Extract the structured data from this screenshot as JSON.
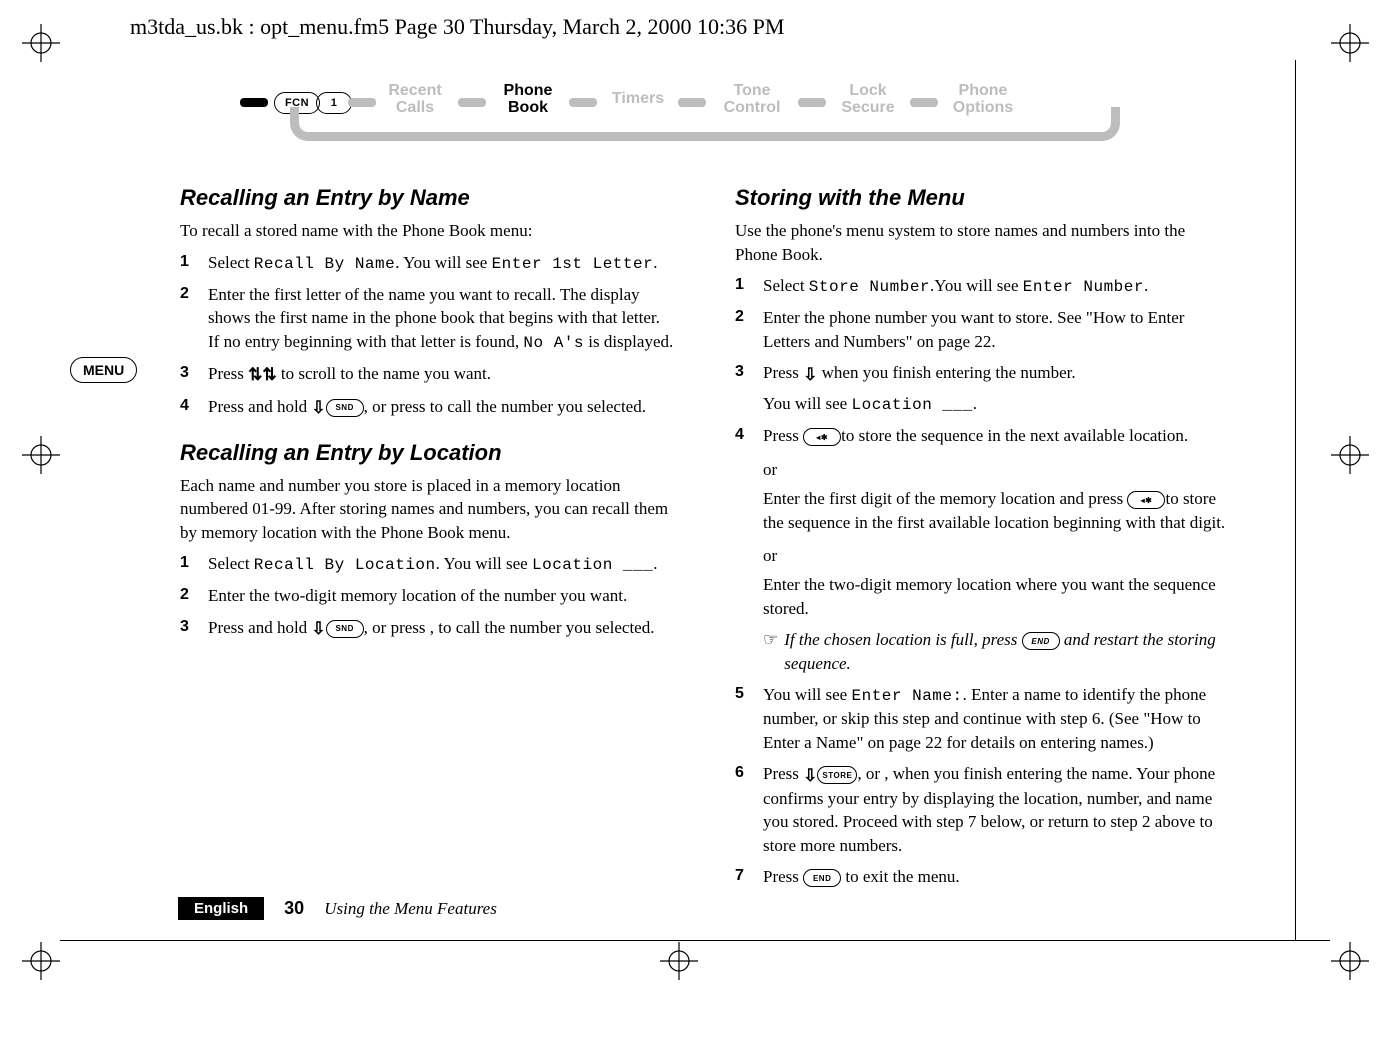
{
  "meta": {
    "headerline": "m3tda_us.bk : opt_menu.fm5  Page 30  Thursday, March 2, 2000  10:36 PM"
  },
  "side": {
    "menu_label": "MENU"
  },
  "nav": {
    "fcn_label": "FCN",
    "num_label": "1",
    "items": [
      {
        "line1": "Recent",
        "line2": "Calls"
      },
      {
        "line1": "Phone",
        "line2": "Book"
      },
      {
        "line1": "Timers",
        "line2": ""
      },
      {
        "line1": "Tone",
        "line2": "Control"
      },
      {
        "line1": "Lock",
        "line2": "Secure"
      },
      {
        "line1": "Phone",
        "line2": "Options"
      }
    ]
  },
  "left": {
    "h1": "Recalling an Entry by Name",
    "p1": "To recall a stored name with the Phone Book menu:",
    "steps1": [
      {
        "n": "1",
        "pre": "Select ",
        "code": "Recall By Name",
        "mid": ". You will see ",
        "code2": "Enter 1st Letter",
        "post": "."
      },
      {
        "n": "2",
        "pre": "Enter the first letter of the name you want to recall. The display shows the first name in the phone book that begins with that letter. If no entry beginning with that letter is found, ",
        "code": "No A's",
        "post": " is displayed."
      },
      {
        "n": "3",
        "pre": "Press ",
        "sym": "updown",
        "post": " to scroll to the name you want."
      },
      {
        "n": "4",
        "pre": "Press and hold ",
        "sym": "down",
        "mid": ", or press ",
        "key": "SND",
        "post": " to call the number you selected."
      }
    ],
    "h2": "Recalling an Entry by Location",
    "p2": "Each name and number you store is placed in a memory location numbered 01-99. After storing names and numbers, you can recall them by memory location with the Phone Book menu.",
    "steps2": [
      {
        "n": "1",
        "pre": "Select ",
        "code": "Recall By Location",
        "mid": ". You will see ",
        "code2": "Location ___",
        "post": "."
      },
      {
        "n": "2",
        "pre": "Enter the two-digit memory location of the number you want."
      },
      {
        "n": "3",
        "pre": "Press and hold ",
        "sym": "down",
        "mid": ", or press ",
        "key": "SND",
        "post": ", to call the number you selected."
      }
    ]
  },
  "right": {
    "h1": "Storing with the Menu",
    "p1": "Use the phone's menu system to store names and numbers into the Phone Book.",
    "steps": [
      {
        "n": "1",
        "pre": "Select ",
        "code": "Store Number",
        "mid": ".You will see ",
        "code2": "Enter Number",
        "post": "."
      },
      {
        "n": "2",
        "pre": "Enter the phone number you want to store. See \"How to Enter Letters and Numbers\" on page 22."
      },
      {
        "n": "3",
        "pre": "Press ",
        "sym": "down",
        "post": " when you finish entering the number.",
        "extra_pre": "You will see ",
        "extra_code": "Location ___",
        "extra_post": "."
      },
      {
        "n": "4",
        "pre": "Press ",
        "key": "◂✱",
        "post": "to store the sequence in the next available location.",
        "or1": "or",
        "or1_body_pre": "Enter the first digit of the memory location and press ",
        "or1_key": "◂✱",
        "or1_body_post": "to store the sequence in the first available location beginning with that digit.",
        "or2": "or",
        "or2_body": "Enter the two-digit memory location where you want the sequence stored."
      },
      {
        "note_pre": "If the chosen location is full, press ",
        "note_key": "END",
        "note_post": " and restart the storing sequence."
      },
      {
        "n": "5",
        "pre": "You will see ",
        "code": "Enter Name:",
        "post": ". Enter a name to identify the phone number, or skip this step and continue with step 6. (See \"How to Enter a Name\" on page 22 for details on entering names.)"
      },
      {
        "n": "6",
        "pre": "Press ",
        "sym": "down",
        "mid": ", or ",
        "key": "STORE",
        "post": ", when you finish entering the name. Your phone confirms your entry by displaying the location, number, and name you stored. Proceed with step 7 below, or return to step 2 above to store more numbers."
      },
      {
        "n": "7",
        "pre": "Press ",
        "key": "END",
        "post": " to exit the menu."
      }
    ]
  },
  "chart_data": null,
  "footer": {
    "lang": "English",
    "page": "30",
    "chapter": "Using the Menu Features"
  }
}
